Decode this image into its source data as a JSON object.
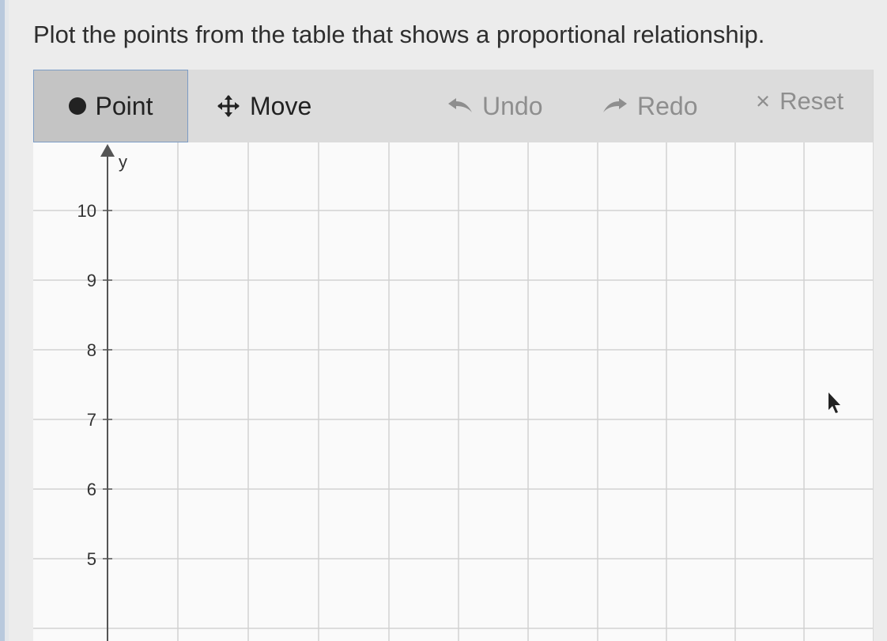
{
  "prompt": "Plot the points from the table that shows a proportional relationship.",
  "toolbar": {
    "point_label": "Point",
    "move_label": "Move",
    "undo_label": "Undo",
    "redo_label": "Redo",
    "reset_label": "Reset",
    "reset_glyph": "×",
    "active_tool": "point",
    "icons": {
      "point": "filled-circle-icon",
      "move": "move-arrows-icon",
      "undo": "undo-arrow-icon",
      "redo": "redo-arrow-icon",
      "reset": "close-x-icon"
    }
  },
  "graph": {
    "y_axis_label": "y",
    "y_ticks": [
      "10",
      "9",
      "8",
      "7",
      "6",
      "5"
    ],
    "grid_color": "#d2d2d2",
    "axis_color": "#555555"
  }
}
